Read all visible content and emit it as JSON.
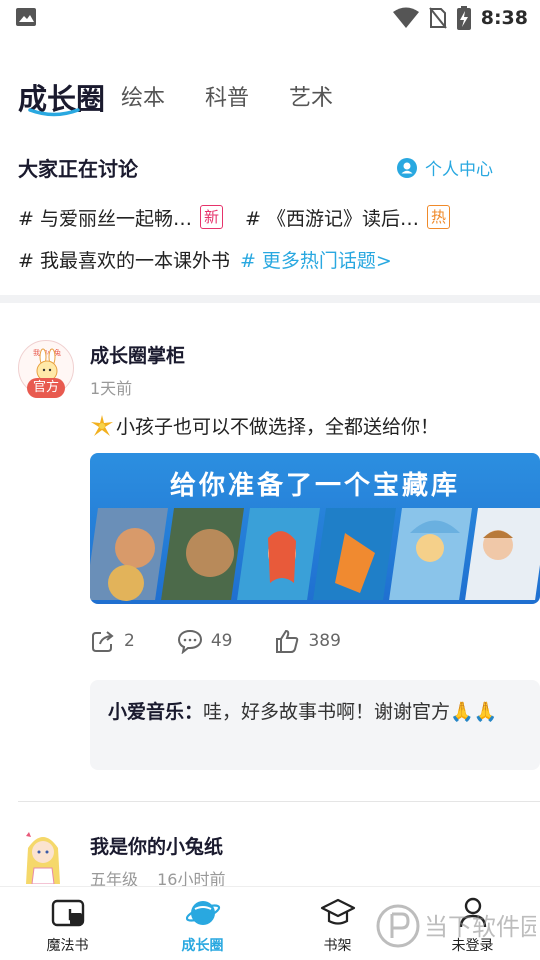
{
  "status_bar": {
    "time": "8:38"
  },
  "tabs": [
    {
      "label": "成长圈",
      "active": true
    },
    {
      "label": "绘本",
      "active": false
    },
    {
      "label": "科普",
      "active": false
    },
    {
      "label": "艺术",
      "active": false
    }
  ],
  "discussion": {
    "title": "大家正在讨论",
    "profile_link": "个人中心",
    "topics": [
      {
        "text": "# 与爱丽丝一起畅…",
        "badge": "新"
      },
      {
        "text": "# 《西游记》读后…",
        "badge": "热"
      },
      {
        "text": "# 我最喜欢的一本课外书"
      }
    ],
    "more_topics": "# 更多热门话题>"
  },
  "posts": [
    {
      "author": "成长圈掌柜",
      "official_tag": "官方",
      "avatar_text": "我的小兔",
      "time": "1天前",
      "text": "小孩子也可以不做选择，全都送给你！",
      "banner_title": "给你准备了一个宝藏库",
      "shares": "2",
      "comments": "49",
      "likes": "389",
      "comment": {
        "name": "小爱音乐：",
        "text": "哇，好多故事书啊！谢谢官方🙏🙏"
      }
    },
    {
      "author": "我是你的小兔纸",
      "grade": "五年级",
      "time": "16小时前"
    }
  ],
  "bottom_nav": [
    {
      "label": "魔法书",
      "icon": "magic-book-icon",
      "active": false
    },
    {
      "label": "成长圈",
      "icon": "planet-icon",
      "active": true
    },
    {
      "label": "书架",
      "icon": "graduation-cap-icon",
      "active": false
    },
    {
      "label": "未登录",
      "icon": "user-icon",
      "active": false
    }
  ],
  "watermark": "当下软件园",
  "colors": {
    "accent": "#29a8e0",
    "new_badge": "#e6336b",
    "hot_badge": "#f08a2a",
    "official": "#e85a4f",
    "banner": "#1f6fd0"
  }
}
